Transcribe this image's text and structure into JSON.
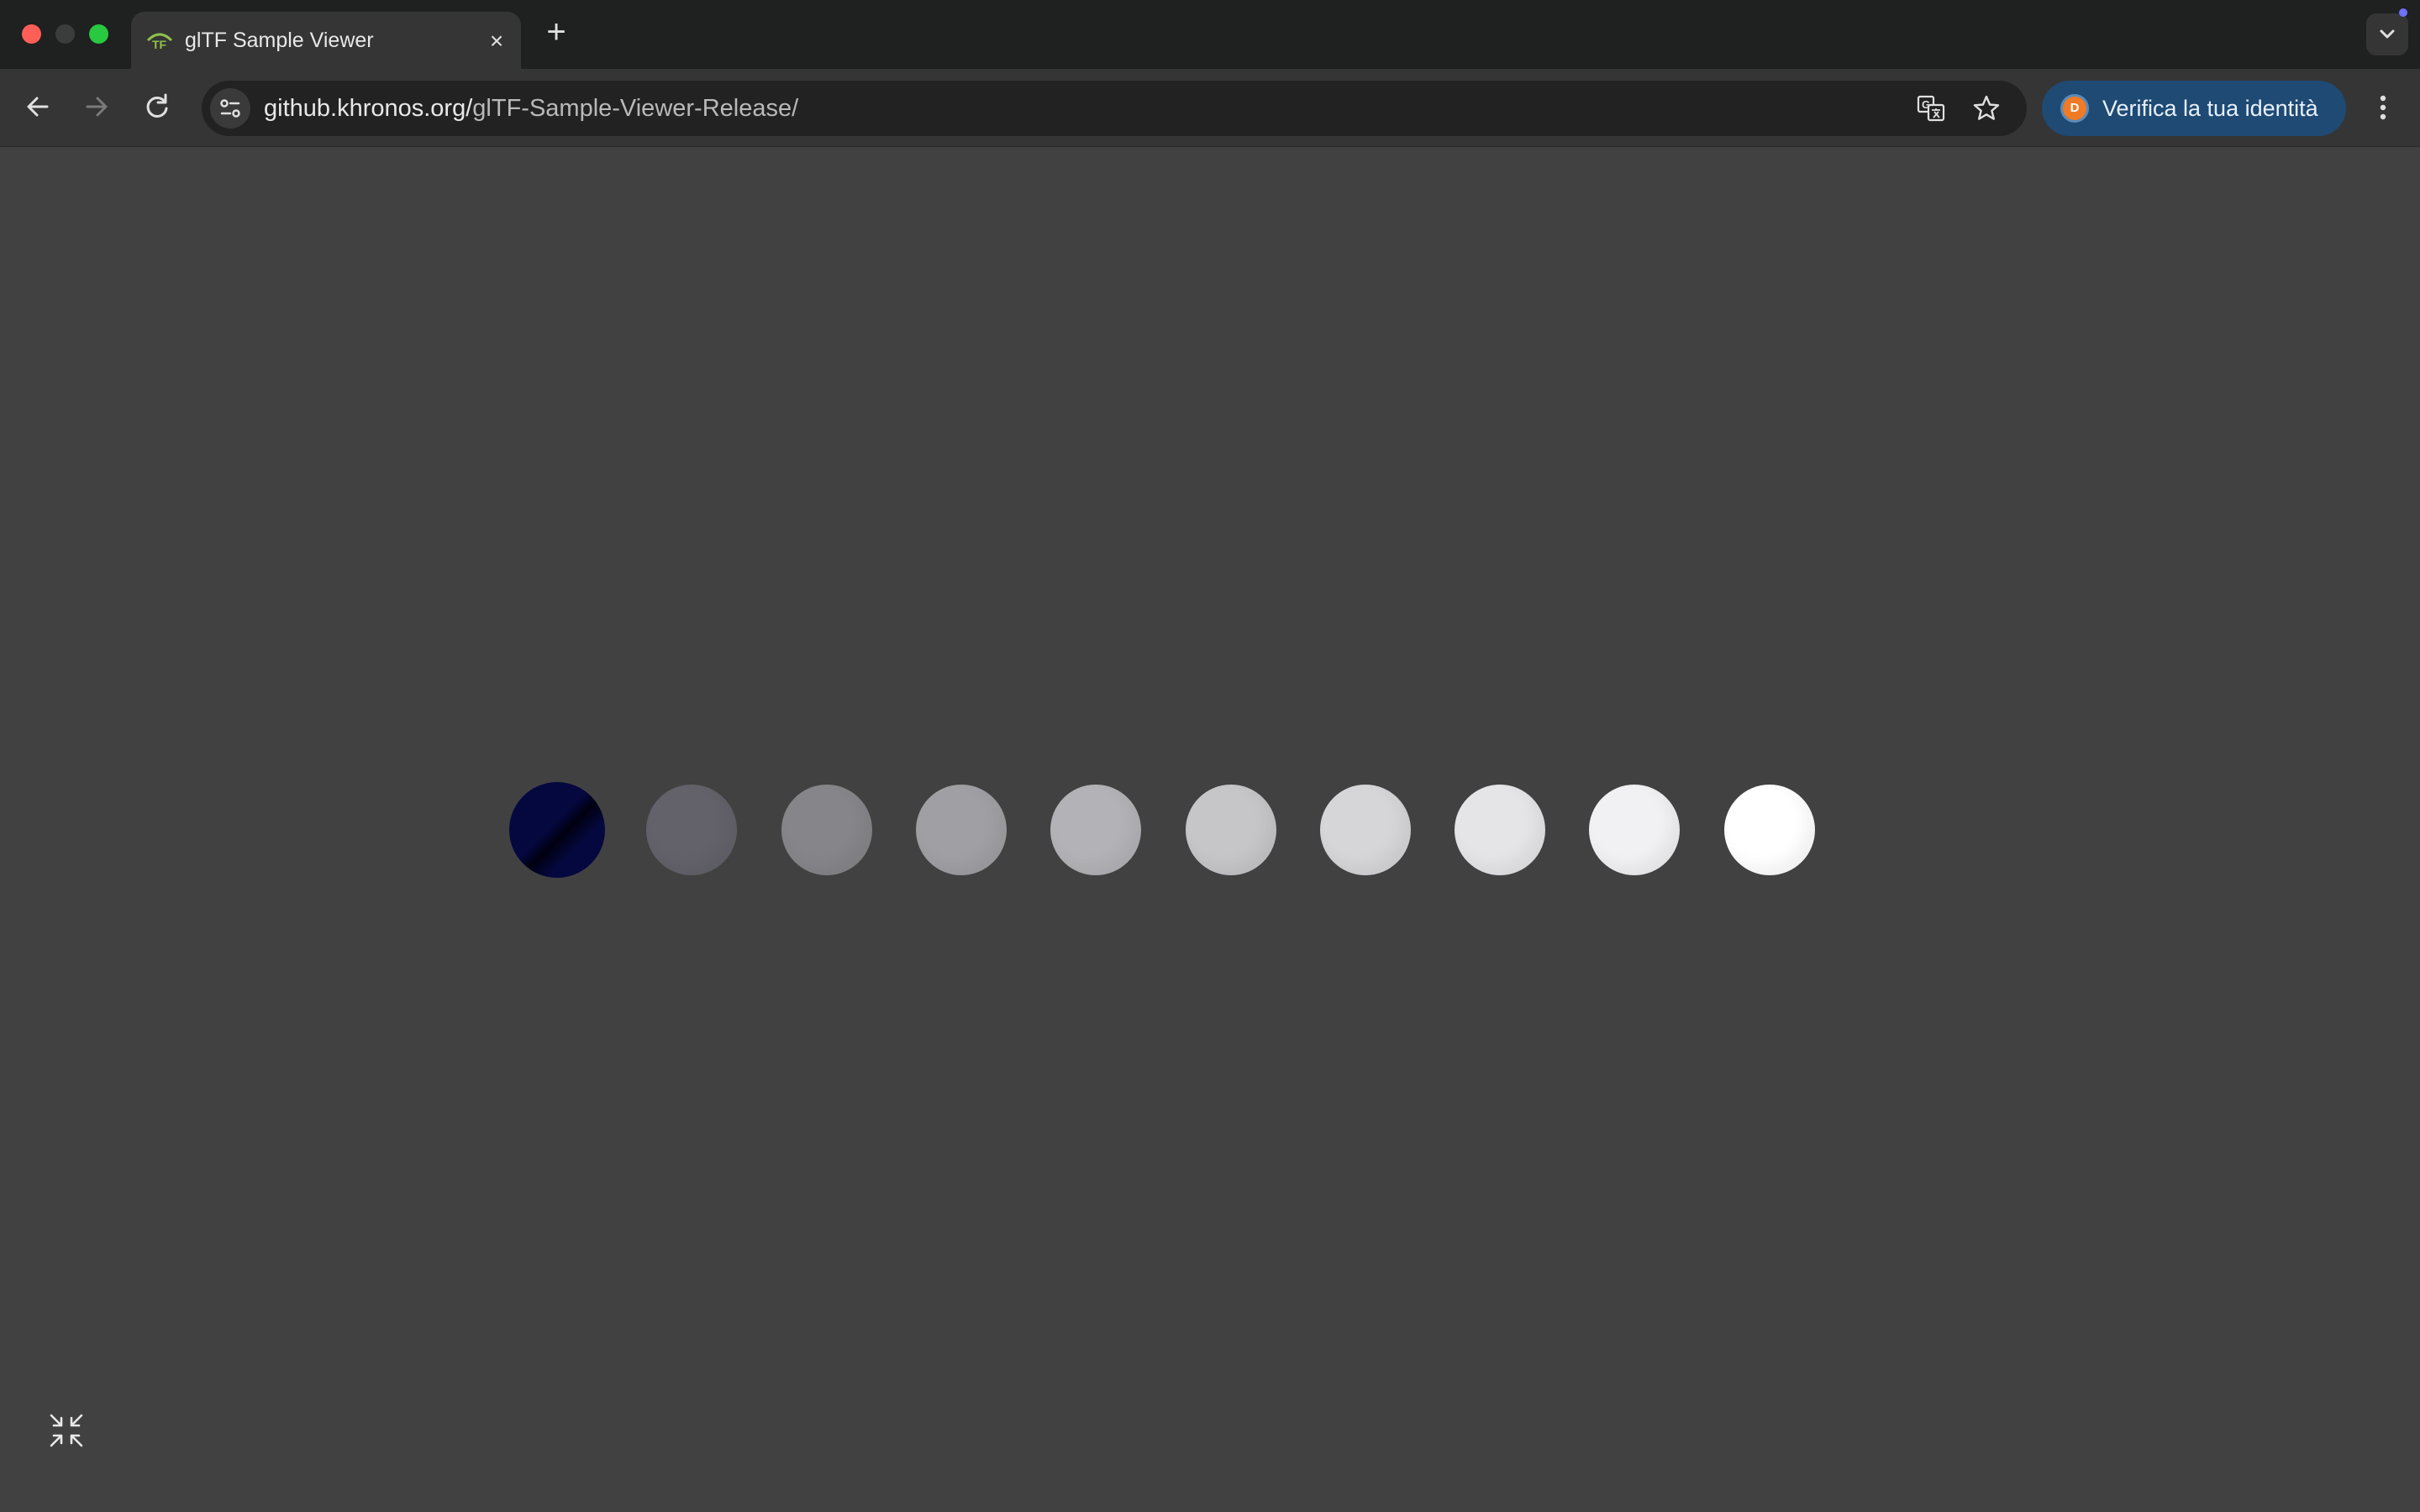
{
  "browser": {
    "tab": {
      "title": "glTF Sample Viewer",
      "favicon": "gltf-logo-icon",
      "close": "×"
    },
    "new_tab": "+",
    "omnibox": {
      "url_host": "github.khronos.org/",
      "url_path": "glTF-Sample-Viewer-Release/"
    },
    "profile": {
      "avatar_initial": "D",
      "label": "Verifica la tua identità"
    }
  },
  "viewer": {
    "background": "#414141",
    "spheres": [
      {
        "name": "sphere-1",
        "color": "#05083f"
      },
      {
        "name": "sphere-2",
        "color": "#63626a"
      },
      {
        "name": "sphere-3",
        "color": "#86868a"
      },
      {
        "name": "sphere-4",
        "color": "#a0a0a4"
      },
      {
        "name": "sphere-5",
        "color": "#b3b3b7"
      },
      {
        "name": "sphere-6",
        "color": "#c6c6c9"
      },
      {
        "name": "sphere-7",
        "color": "#d6d6d9"
      },
      {
        "name": "sphere-8",
        "color": "#e5e5e8"
      },
      {
        "name": "sphere-9",
        "color": "#f1f1f3"
      },
      {
        "name": "sphere-10",
        "color": "#ffffff"
      }
    ],
    "collapse_icon": "collapse-arrows-icon"
  }
}
